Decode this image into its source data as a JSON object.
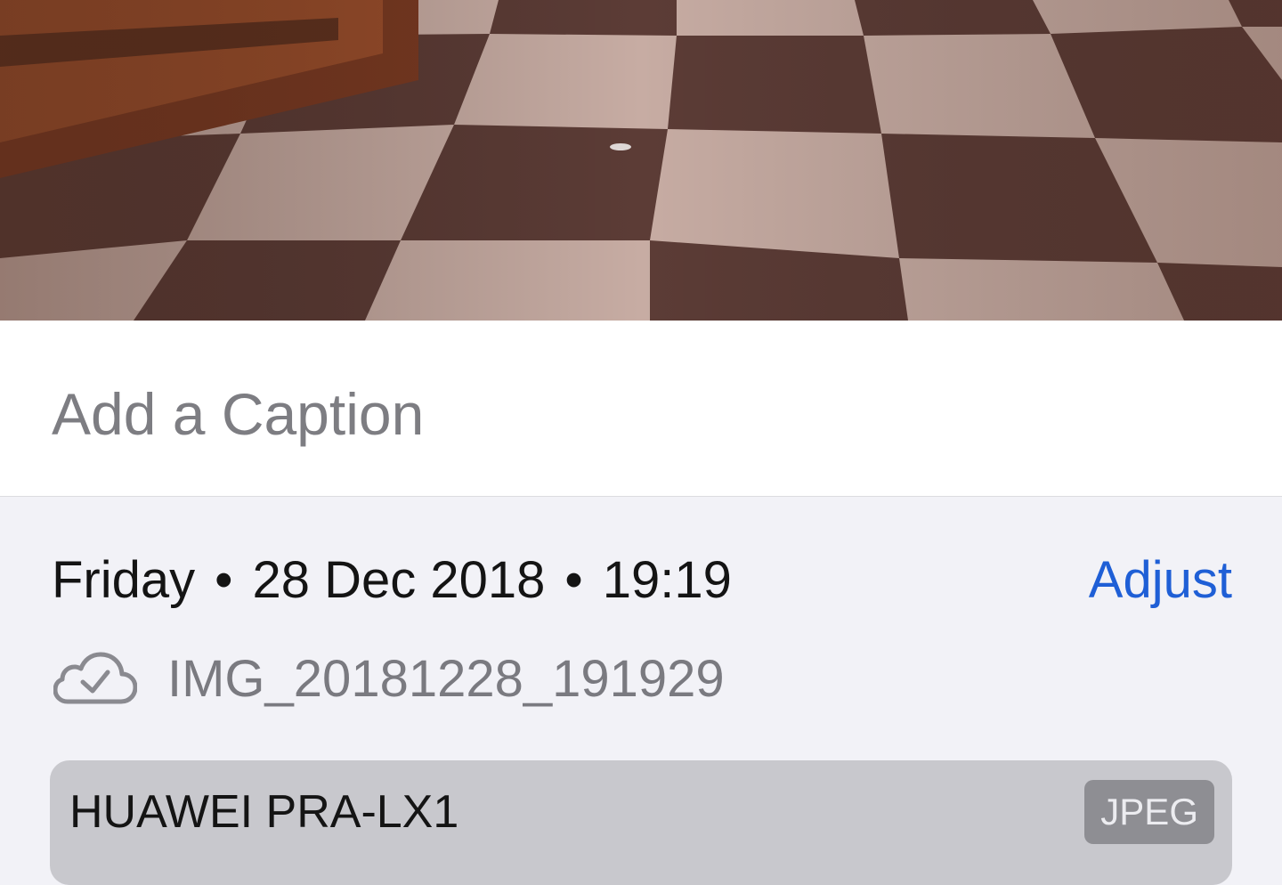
{
  "photo": {
    "description_icon": "photo-preview"
  },
  "caption": {
    "placeholder": "Add a Caption"
  },
  "info": {
    "day": "Friday",
    "date": "28 Dec 2018",
    "time": "19:19",
    "separator": "•",
    "adjust_label": "Adjust",
    "filename": "IMG_20181228_191929",
    "cloud_icon": "icloud-synced-icon"
  },
  "device": {
    "name": "HUAWEI PRA-LX1",
    "format": "JPEG"
  },
  "colors": {
    "accent": "#1f5fd6",
    "background": "#f2f2f7",
    "card": "#c8c8cd"
  }
}
